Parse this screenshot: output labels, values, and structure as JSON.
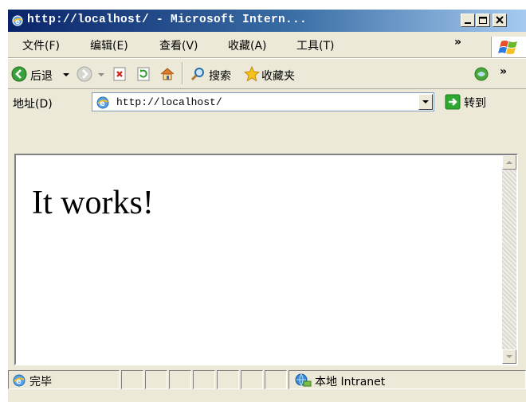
{
  "window": {
    "title": "http://localhost/ - Microsoft Intern..."
  },
  "menubar": {
    "items": [
      "文件(F)",
      "编辑(E)",
      "查看(V)",
      "收藏(A)",
      "工具(T)"
    ],
    "overflow": "»"
  },
  "toolbar": {
    "back_label": "后退",
    "search_label": "搜索",
    "favorites_label": "收藏夹",
    "overflow": "»"
  },
  "addressbar": {
    "label": "地址(D)",
    "url": "http://localhost/",
    "go_label": "转到"
  },
  "page": {
    "heading": "It works!"
  },
  "statusbar": {
    "status": "完毕",
    "zone": "本地 Intranet"
  },
  "colors": {
    "title_start": "#0a246a",
    "title_end": "#a6caf0",
    "chrome": "#ece9d8",
    "content_bg": "#ffffff"
  }
}
